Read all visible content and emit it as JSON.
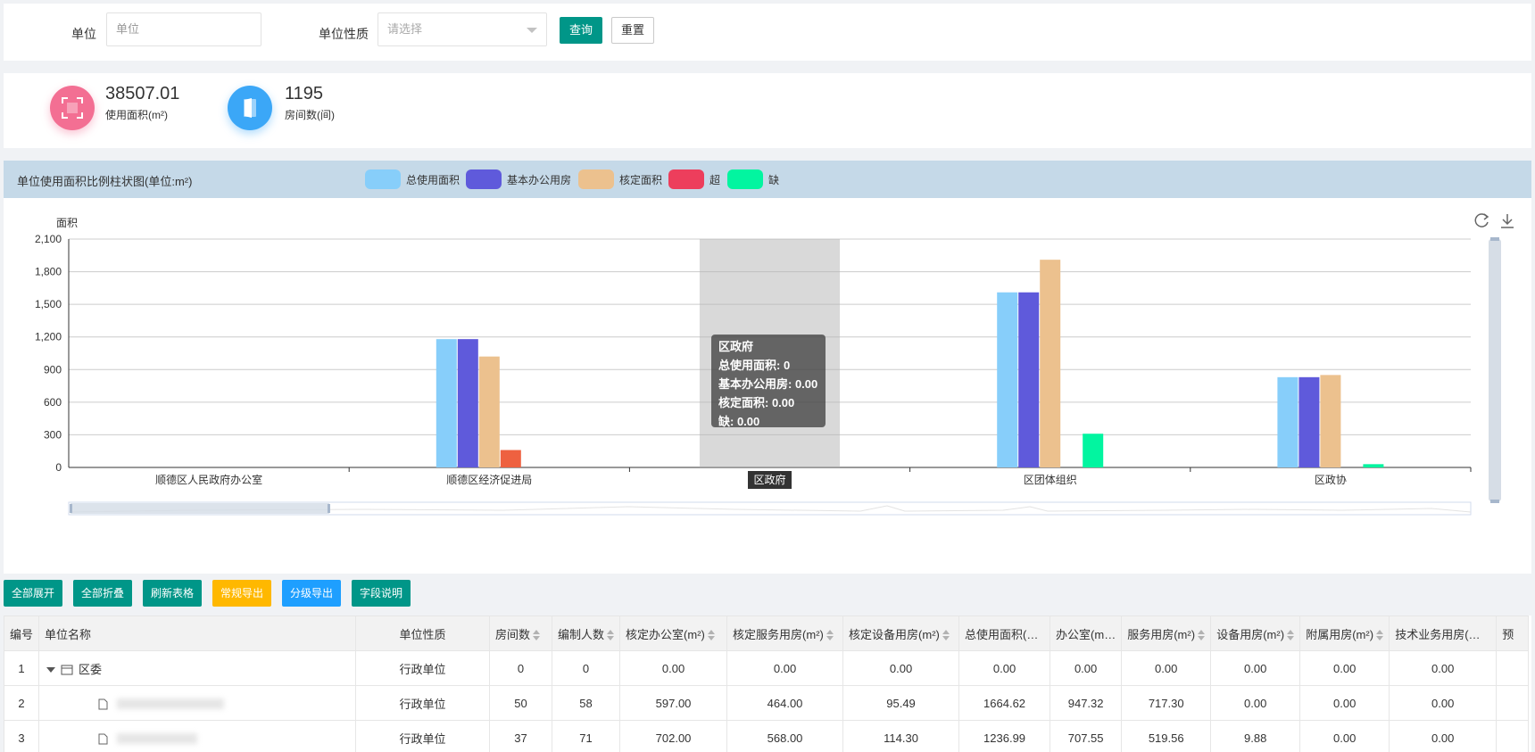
{
  "filter": {
    "unit_label": "单位",
    "unit_placeholder": "单位",
    "nature_label": "单位性质",
    "nature_placeholder": "请选择",
    "query_button": "查询",
    "reset_button": "重置"
  },
  "stats": [
    {
      "value": "38507.01",
      "label": "使用面积(m²)",
      "color": "#f36f93",
      "icon": "area-icon"
    },
    {
      "value": "1195",
      "label": "房间数(间)",
      "color": "#3ba7f7",
      "icon": "door-icon"
    }
  ],
  "chart_panel": {
    "title": "单位使用面积比例柱状图(单位:m²)",
    "toolbar": [
      "refresh-icon",
      "download-icon"
    ]
  },
  "chart_data": {
    "type": "bar",
    "ylabel": "面积",
    "ylim": [
      0,
      2100
    ],
    "yticks": [
      "0",
      "300",
      "600",
      "900",
      "1,200",
      "1,500",
      "1,800",
      "2,100"
    ],
    "categories": [
      "顺德区人民政府办公室",
      "顺德区经济促进局",
      "区政府",
      "区团体组织",
      "区政协"
    ],
    "highlighted_category": "区政府",
    "series": [
      {
        "name": "总使用面积",
        "color": "#87cefa",
        "values": [
          0,
          1180,
          0,
          1610,
          830
        ]
      },
      {
        "name": "基本办公用房",
        "color": "#5f5adb",
        "values": [
          0,
          1180,
          0,
          1610,
          830
        ]
      },
      {
        "name": "核定面积",
        "color": "#ecc18e",
        "values": [
          0,
          1020,
          0,
          1910,
          850
        ]
      },
      {
        "name": "超",
        "color": "#ed3e5c",
        "values": [
          0,
          160,
          0,
          0,
          0
        ]
      },
      {
        "name": "缺",
        "color": "#02f5a0",
        "values": [
          0,
          0,
          0,
          310,
          30
        ]
      }
    ],
    "tooltip": {
      "title": "区政府",
      "lines": [
        "总使用面积: 0",
        "基本办公用房: 0.00",
        "核定面积: 0.00",
        "缺: 0.00"
      ]
    }
  },
  "toolbar_buttons": [
    {
      "label": "全部展开",
      "color": "#009688"
    },
    {
      "label": "全部折叠",
      "color": "#009688"
    },
    {
      "label": "刷新表格",
      "color": "#009688"
    },
    {
      "label": "常规导出",
      "color": "#ffb800"
    },
    {
      "label": "分级导出",
      "color": "#1e9fff"
    },
    {
      "label": "字段说明",
      "color": "#009688"
    }
  ],
  "table": {
    "headers": [
      "编号",
      "单位名称",
      "单位性质",
      "房间数",
      "编制人数",
      "核定办公室(m²)",
      "核定服务用房(m²)",
      "核定设备用房(m²)",
      "总使用面积(…",
      "办公室(m…",
      "服务用房(m²)",
      "设备用房(m²)",
      "附属用房(m²)",
      "技术业务用房(…",
      "预"
    ],
    "rows": [
      {
        "no": "1",
        "name": "区委",
        "nature": "行政单位",
        "cells": [
          "0",
          "0",
          "0.00",
          "0.00",
          "0.00",
          "0.00",
          "0.00",
          "0.00",
          "0.00",
          "0.00",
          "0.00"
        ]
      },
      {
        "no": "2",
        "name": "",
        "nature": "行政单位",
        "cells": [
          "50",
          "58",
          "597.00",
          "464.00",
          "95.49",
          "1664.62",
          "947.32",
          "717.30",
          "0.00",
          "0.00",
          "0.00"
        ]
      },
      {
        "no": "3",
        "name": "",
        "nature": "行政单位",
        "cells": [
          "37",
          "71",
          "702.00",
          "568.00",
          "114.30",
          "1236.99",
          "707.55",
          "519.56",
          "9.88",
          "0.00",
          "0.00"
        ]
      }
    ]
  }
}
